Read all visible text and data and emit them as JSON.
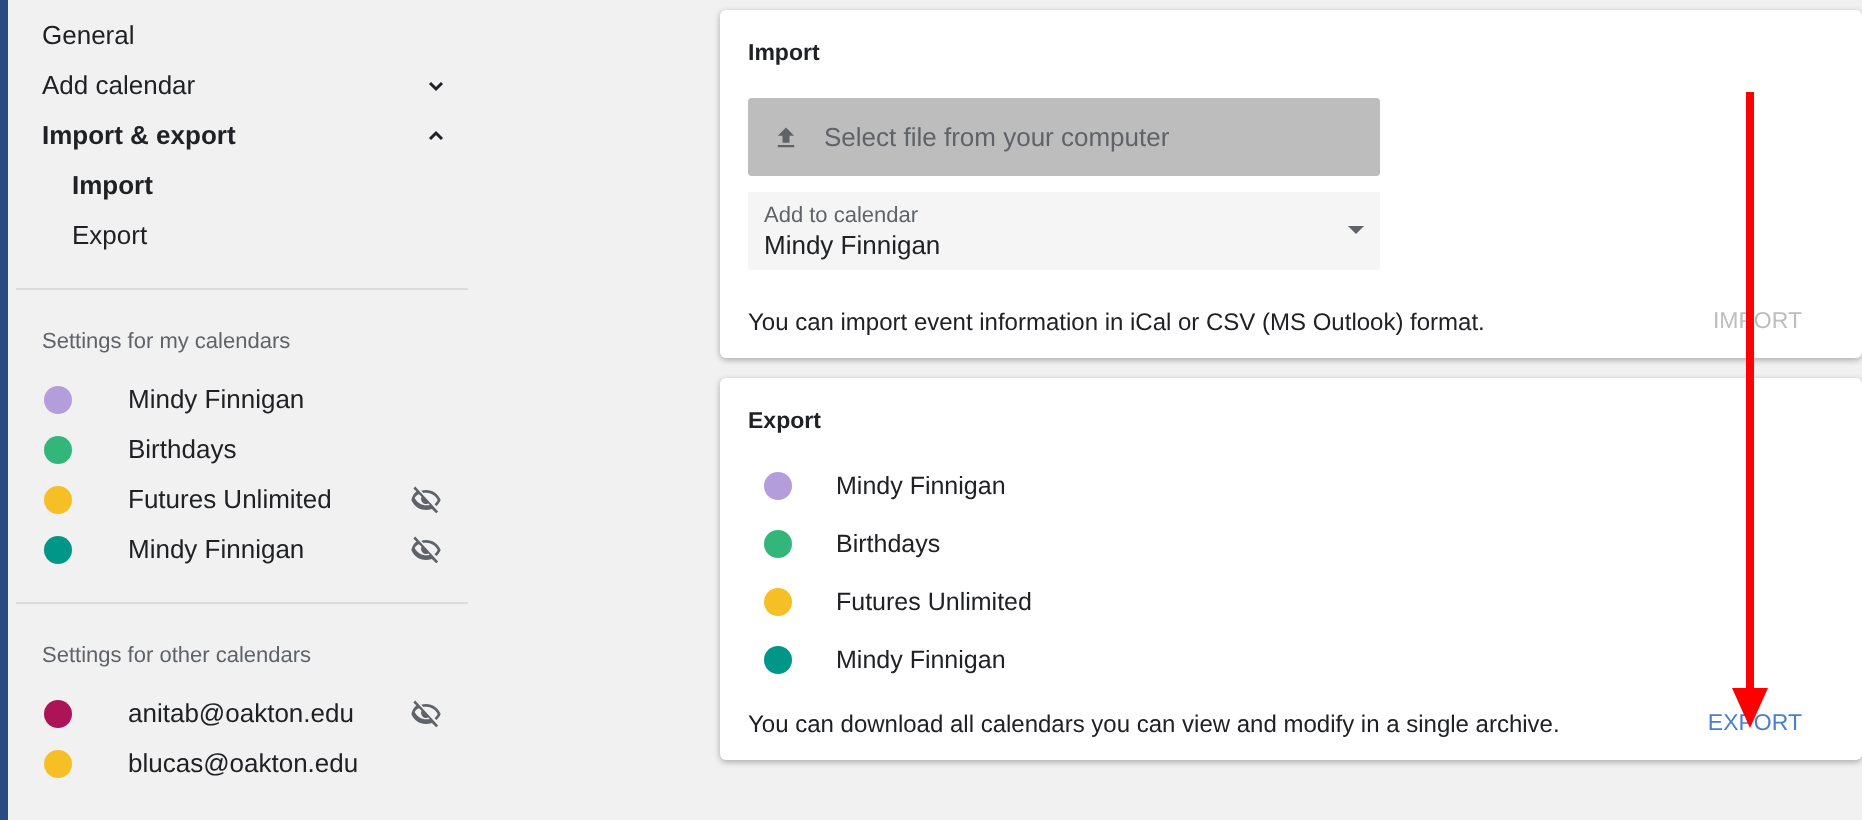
{
  "sidebar": {
    "nav": [
      {
        "kind": "item",
        "label": "General"
      },
      {
        "kind": "group",
        "label": "Add calendar",
        "expanded": false
      },
      {
        "kind": "group",
        "label": "Import & export",
        "expanded": true,
        "children": [
          {
            "label": "Import",
            "selected": true
          },
          {
            "label": "Export",
            "selected": false
          }
        ]
      }
    ],
    "sections": [
      {
        "heading": "Settings for my calendars",
        "calendars": [
          {
            "name": "Mindy Finnigan",
            "color": "#b39ddb",
            "hidden": false
          },
          {
            "name": "Birthdays",
            "color": "#33b679",
            "hidden": false
          },
          {
            "name": "Futures Unlimited",
            "color": "#f6bf26",
            "hidden": true
          },
          {
            "name": "Mindy Finnigan",
            "color": "#009688",
            "hidden": true
          }
        ]
      },
      {
        "heading": "Settings for other calendars",
        "calendars": [
          {
            "name": "anitab@oakton.edu",
            "color": "#ad1457",
            "hidden": true
          },
          {
            "name": "blucas@oakton.edu",
            "color": "#f6bf26",
            "hidden": false
          }
        ]
      }
    ]
  },
  "import": {
    "title": "Import",
    "file_button": "Select file from your computer",
    "calendar_field": {
      "label": "Add to calendar",
      "value": "Mindy Finnigan"
    },
    "description": "You can import event information in iCal or CSV (MS Outlook) format.",
    "button": {
      "label": "IMPORT",
      "disabled": true
    }
  },
  "export": {
    "title": "Export",
    "calendars": [
      {
        "name": "Mindy Finnigan",
        "color": "#b39ddb"
      },
      {
        "name": "Birthdays",
        "color": "#33b679"
      },
      {
        "name": "Futures Unlimited",
        "color": "#f6bf26"
      },
      {
        "name": "Mindy Finnigan",
        "color": "#009688"
      }
    ],
    "description": "You can download all calendars you can view and modify in a single archive.",
    "button": {
      "label": "EXPORT",
      "disabled": false
    }
  }
}
